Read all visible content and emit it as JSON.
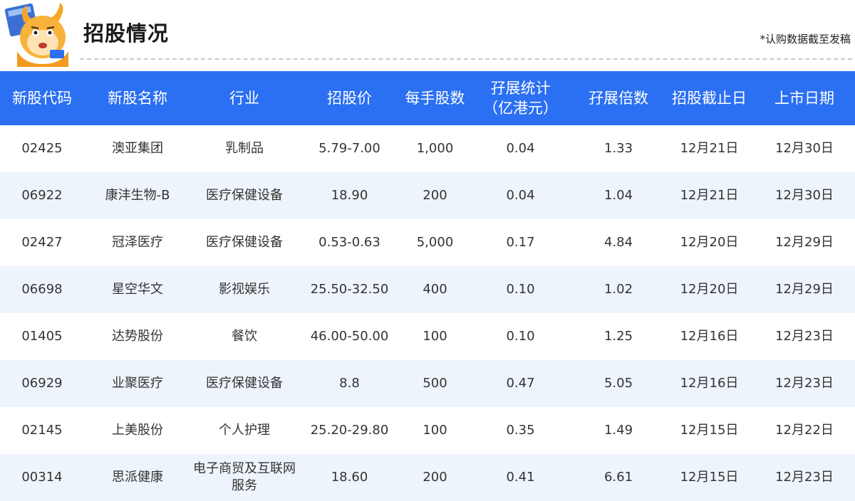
{
  "header": {
    "title": "招股情况",
    "note": "*认购数据截至发稿"
  },
  "table": {
    "columns": [
      "新股代码",
      "新股名称",
      "行业",
      "招股价",
      "每手股数",
      "孖展统计\n（亿港元）",
      "孖展倍数",
      "招股截止日",
      "上市日期"
    ],
    "rows": [
      [
        "02425",
        "澳亚集团",
        "乳制品",
        "5.79-7.00",
        "1,000",
        "0.04",
        "1.33",
        "12月21日",
        "12月30日"
      ],
      [
        "06922",
        "康沣生物-B",
        "医疗保健设备",
        "18.90",
        "200",
        "0.04",
        "1.04",
        "12月21日",
        "12月30日"
      ],
      [
        "02427",
        "冠泽医疗",
        "医疗保健设备",
        "0.53-0.63",
        "5,000",
        "0.17",
        "4.84",
        "12月20日",
        "12月29日"
      ],
      [
        "06698",
        "星空华文",
        "影视娱乐",
        "25.50-32.50",
        "400",
        "0.10",
        "1.02",
        "12月20日",
        "12月29日"
      ],
      [
        "01405",
        "达势股份",
        "餐饮",
        "46.00-50.00",
        "100",
        "0.10",
        "1.25",
        "12月16日",
        "12月23日"
      ],
      [
        "06929",
        "业聚医疗",
        "医疗保健设备",
        "8.8",
        "500",
        "0.47",
        "5.05",
        "12月16日",
        "12月23日"
      ],
      [
        "02145",
        "上美股份",
        "个人护理",
        "25.20-29.80",
        "100",
        "0.35",
        "1.49",
        "12月15日",
        "12月22日"
      ],
      [
        "00314",
        "思派健康",
        "电子商贸及互联网\n服务",
        "18.60",
        "200",
        "0.41",
        "6.61",
        "12月15日",
        "12月23日"
      ]
    ]
  }
}
